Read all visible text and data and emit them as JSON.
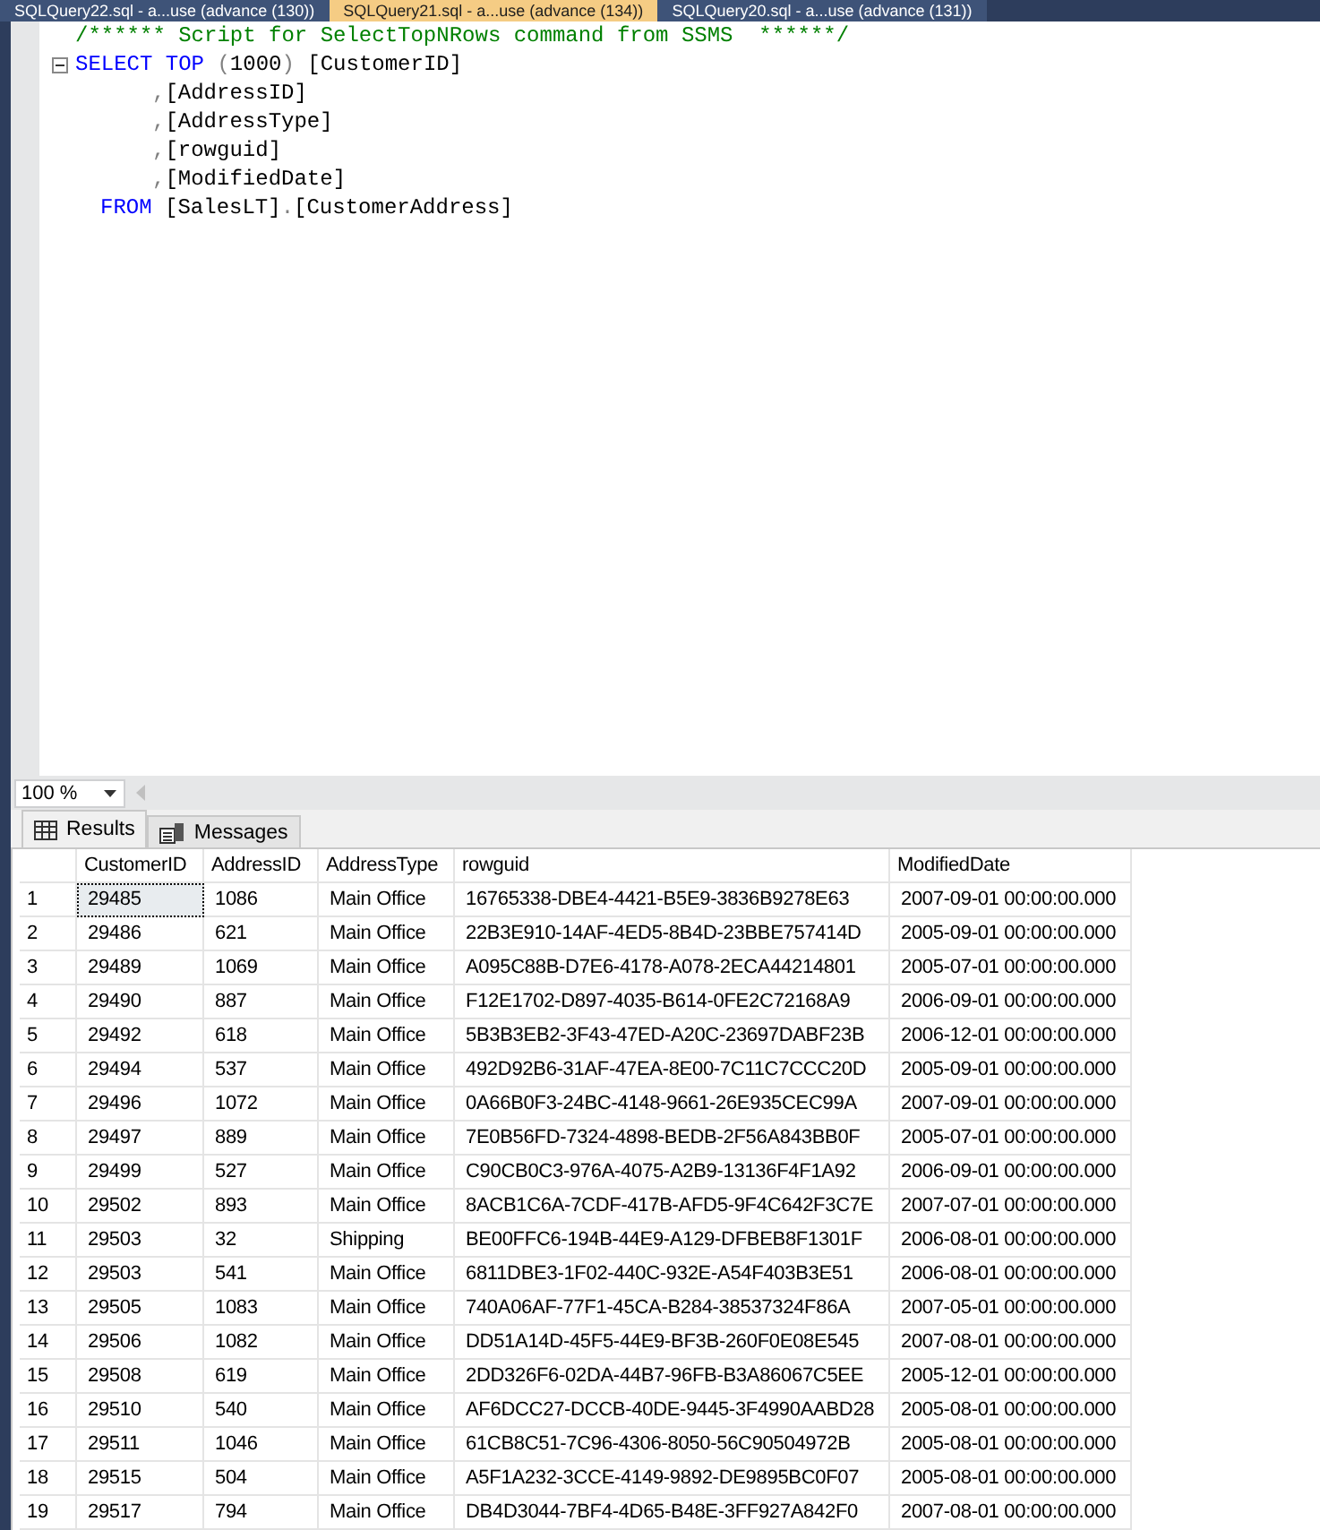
{
  "document_tabs": [
    {
      "label": "SQLQuery22.sql - a...use (advance (130))",
      "selected": false
    },
    {
      "label": "SQLQuery21.sql - a...use (advance (134))",
      "selected": true
    },
    {
      "label": "SQLQuery20.sql - a...use (advance (131))",
      "selected": false
    }
  ],
  "editor": {
    "lines": [
      {
        "collapsible": false,
        "tokens": [
          {
            "kind": "comment",
            "text": "/****** Script for SelectTopNRows command from SSMS  ******/"
          }
        ]
      },
      {
        "collapsible": true,
        "tokens": [
          {
            "kind": "keyword",
            "text": "SELECT TOP "
          },
          {
            "kind": "punct",
            "text": "("
          },
          {
            "kind": "plain",
            "text": "1000"
          },
          {
            "kind": "punct",
            "text": ")"
          },
          {
            "kind": "plain",
            "text": " [CustomerID]"
          }
        ]
      },
      {
        "collapsible": false,
        "kind": "column",
        "tokens": [
          {
            "kind": "punct",
            "text": ","
          },
          {
            "kind": "plain",
            "text": "[AddressID]"
          }
        ]
      },
      {
        "collapsible": false,
        "kind": "column",
        "tokens": [
          {
            "kind": "punct",
            "text": ","
          },
          {
            "kind": "plain",
            "text": "[AddressType]"
          }
        ]
      },
      {
        "collapsible": false,
        "kind": "column",
        "tokens": [
          {
            "kind": "punct",
            "text": ","
          },
          {
            "kind": "plain",
            "text": "[rowguid]"
          }
        ]
      },
      {
        "collapsible": false,
        "kind": "column",
        "tokens": [
          {
            "kind": "punct",
            "text": ","
          },
          {
            "kind": "plain",
            "text": "[ModifiedDate]"
          }
        ]
      },
      {
        "collapsible": false,
        "kind": "clause",
        "tokens": [
          {
            "kind": "keyword",
            "text": "FROM"
          },
          {
            "kind": "plain",
            "text": " [SalesLT]"
          },
          {
            "kind": "punct",
            "text": "."
          },
          {
            "kind": "plain",
            "text": "[CustomerAddress]"
          }
        ]
      }
    ]
  },
  "zoom": {
    "value": "100 %"
  },
  "result_tabs": [
    {
      "label": "Results",
      "kind": "grid",
      "selected": true
    },
    {
      "label": "Messages",
      "kind": "messages",
      "selected": false
    }
  ],
  "table": {
    "columns": [
      "CustomerID",
      "AddressID",
      "AddressType",
      "rowguid",
      "ModifiedDate"
    ],
    "rows": [
      {
        "number": "1",
        "selected": true,
        "cells": [
          "29485",
          "1086",
          "Main Office",
          "16765338-DBE4-4421-B5E9-3836B9278E63",
          "2007-09-01 00:00:00.000"
        ]
      },
      {
        "number": "2",
        "selected": false,
        "cells": [
          "29486",
          "621",
          "Main Office",
          "22B3E910-14AF-4ED5-8B4D-23BBE757414D",
          "2005-09-01 00:00:00.000"
        ]
      },
      {
        "number": "3",
        "selected": false,
        "cells": [
          "29489",
          "1069",
          "Main Office",
          "A095C88B-D7E6-4178-A078-2ECA44214801",
          "2005-07-01 00:00:00.000"
        ]
      },
      {
        "number": "4",
        "selected": false,
        "cells": [
          "29490",
          "887",
          "Main Office",
          "F12E1702-D897-4035-B614-0FE2C72168A9",
          "2006-09-01 00:00:00.000"
        ]
      },
      {
        "number": "5",
        "selected": false,
        "cells": [
          "29492",
          "618",
          "Main Office",
          "5B3B3EB2-3F43-47ED-A20C-23697DABF23B",
          "2006-12-01 00:00:00.000"
        ]
      },
      {
        "number": "6",
        "selected": false,
        "cells": [
          "29494",
          "537",
          "Main Office",
          "492D92B6-31AF-47EA-8E00-7C11C7CCC20D",
          "2005-09-01 00:00:00.000"
        ]
      },
      {
        "number": "7",
        "selected": false,
        "cells": [
          "29496",
          "1072",
          "Main Office",
          "0A66B0F3-24BC-4148-9661-26E935CEC99A",
          "2007-09-01 00:00:00.000"
        ]
      },
      {
        "number": "8",
        "selected": false,
        "cells": [
          "29497",
          "889",
          "Main Office",
          "7E0B56FD-7324-4898-BEDB-2F56A843BB0F",
          "2005-07-01 00:00:00.000"
        ]
      },
      {
        "number": "9",
        "selected": false,
        "cells": [
          "29499",
          "527",
          "Main Office",
          "C90CB0C3-976A-4075-A2B9-13136F4F1A92",
          "2006-09-01 00:00:00.000"
        ]
      },
      {
        "number": "10",
        "selected": false,
        "cells": [
          "29502",
          "893",
          "Main Office",
          "8ACB1C6A-7CDF-417B-AFD5-9F4C642F3C7E",
          "2007-07-01 00:00:00.000"
        ]
      },
      {
        "number": "11",
        "selected": false,
        "cells": [
          "29503",
          "32",
          "Shipping",
          "BE00FFC6-194B-44E9-A129-DFBEB8F1301F",
          "2006-08-01 00:00:00.000"
        ]
      },
      {
        "number": "12",
        "selected": false,
        "cells": [
          "29503",
          "541",
          "Main Office",
          "6811DBE3-1F02-440C-932E-A54F403B3E51",
          "2006-08-01 00:00:00.000"
        ]
      },
      {
        "number": "13",
        "selected": false,
        "cells": [
          "29505",
          "1083",
          "Main Office",
          "740A06AF-77F1-45CA-B284-38537324F86A",
          "2007-05-01 00:00:00.000"
        ]
      },
      {
        "number": "14",
        "selected": false,
        "cells": [
          "29506",
          "1082",
          "Main Office",
          "DD51A14D-45F5-44E9-BF3B-260F0E08E545",
          "2007-08-01 00:00:00.000"
        ]
      },
      {
        "number": "15",
        "selected": false,
        "cells": [
          "29508",
          "619",
          "Main Office",
          "2DD326F6-02DA-44B7-96FB-B3A86067C5EE",
          "2005-12-01 00:00:00.000"
        ]
      },
      {
        "number": "16",
        "selected": false,
        "cells": [
          "29510",
          "540",
          "Main Office",
          "AF6DCC27-DCCB-40DE-9445-3F4990AABD28",
          "2005-08-01 00:00:00.000"
        ]
      },
      {
        "number": "17",
        "selected": false,
        "cells": [
          "29511",
          "1046",
          "Main Office",
          "61CB8C51-7C96-4306-8050-56C90504972B",
          "2005-08-01 00:00:00.000"
        ]
      },
      {
        "number": "18",
        "selected": false,
        "cells": [
          "29515",
          "504",
          "Main Office",
          "A5F1A232-3CCE-4149-9892-DE9895BC0F07",
          "2005-08-01 00:00:00.000"
        ]
      },
      {
        "number": "19",
        "selected": false,
        "cells": [
          "29517",
          "794",
          "Main Office",
          "DB4D3044-7BF4-4D65-B48E-3FF927A842F0",
          "2007-08-01 00:00:00.000"
        ]
      }
    ]
  }
}
